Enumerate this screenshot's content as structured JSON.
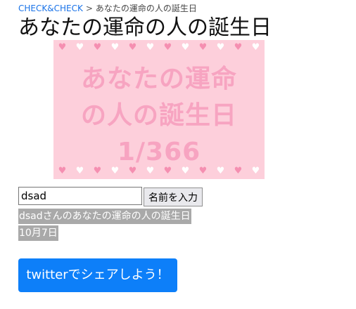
{
  "breadcrumb": {
    "home": "CHECK&CHECK",
    "separator": ">",
    "current": "あなたの運命の人の誕生日"
  },
  "page": {
    "title": "あなたの運命の人の誕生日"
  },
  "banner": {
    "line1": "あなたの運命",
    "line2": "の人の誕生日",
    "line3": "1/366"
  },
  "form": {
    "name_value": "dsad",
    "submit_label": "名前を入力"
  },
  "result": {
    "message": "dsadさんのあなたの運命の人の誕生日",
    "birthday": "10月7日"
  },
  "share": {
    "label": "twitterでシェアしよう！"
  },
  "colors": {
    "link": "#1a73e8",
    "banner_bg": "#fdcfdb",
    "banner_text": "#f7a4c1",
    "share_bg": "#0d7ff9",
    "result_bg": "#a9a9a9"
  },
  "icons": {
    "decoration": "heart-icon"
  }
}
